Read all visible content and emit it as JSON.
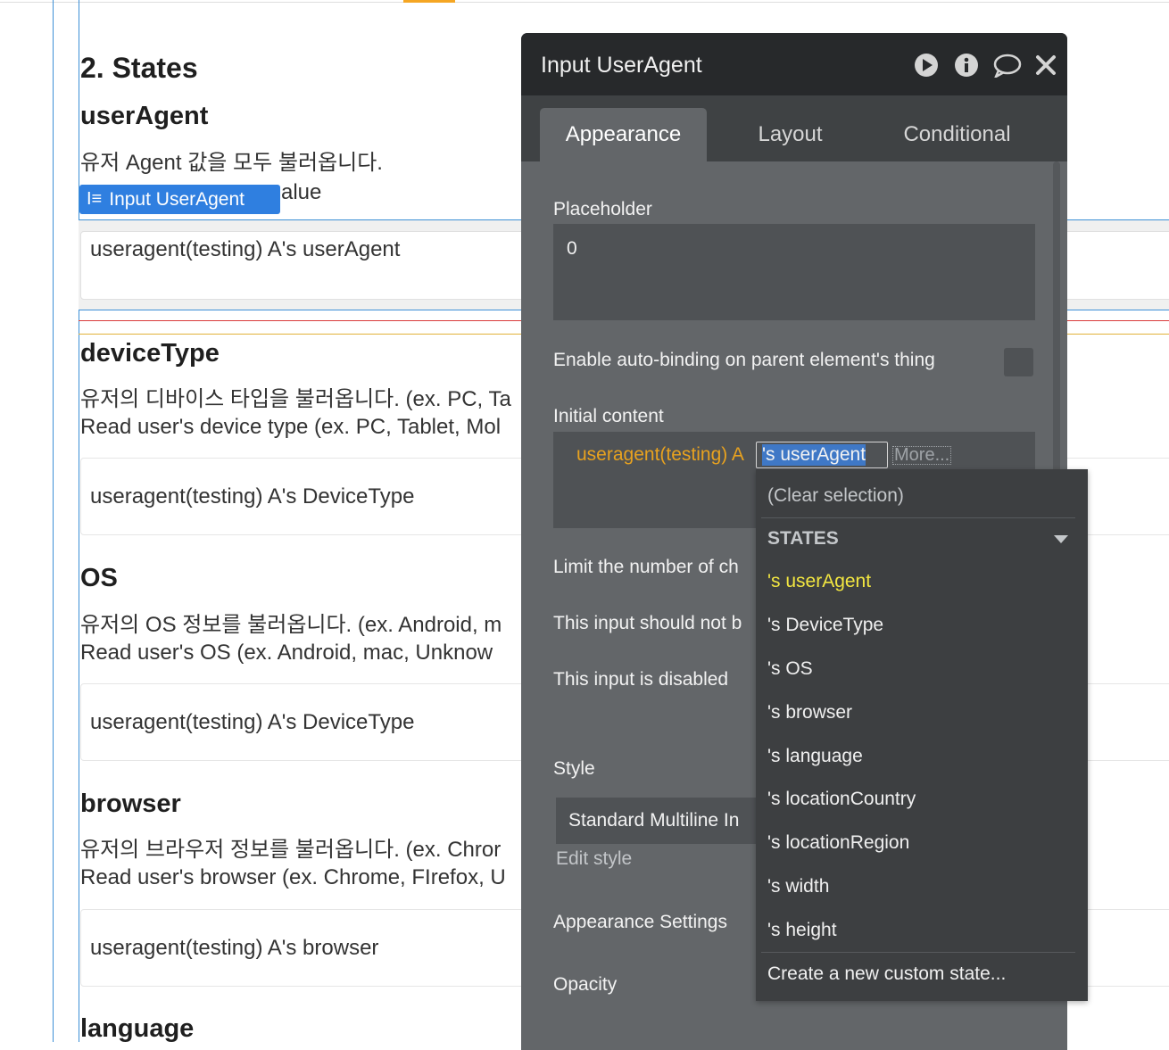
{
  "canvas": {
    "section_title": "2. States",
    "user_agent": {
      "heading": "userAgent",
      "desc_ko": "유저 Agent 값을 모두 불러옵니다.",
      "desc_partial": "alue",
      "element_tag": "Input UserAgent",
      "input_value": "useragent(testing) A's userAgent"
    },
    "device_type": {
      "heading": "deviceType",
      "desc_ko": "유저의 디바이스 타입을 불러옵니다. (ex. PC, Ta",
      "desc_en": "Read user's device type (ex. PC, Tablet, Mol",
      "input_value": "useragent(testing) A's DeviceType"
    },
    "os": {
      "heading": "OS",
      "desc_ko": "유저의 OS  정보를 불러옵니다. (ex. Android, m",
      "desc_en": "Read user's OS (ex. Android, mac, Unknow",
      "input_value": "useragent(testing) A's DeviceType"
    },
    "browser": {
      "heading": "browser",
      "desc_ko": "유저의 브라우저  정보를 불러옵니다. (ex. Chror",
      "desc_en": "Read user's browser (ex. Chrome, FIrefox, U",
      "input_value": "useragent(testing) A's browser"
    },
    "language": {
      "heading": "language"
    }
  },
  "panel": {
    "title": "Input UserAgent",
    "header_icons": [
      "play-icon",
      "info-icon",
      "comment-icon",
      "close-icon"
    ],
    "tabs": [
      "Appearance",
      "Layout",
      "Conditional"
    ],
    "active_tab": "Appearance",
    "placeholder_label": "Placeholder",
    "placeholder_value": "0",
    "autobinding_label": "Enable auto-binding on parent element's thing",
    "initial_content_label": "Initial content",
    "initial_content_prefix": "useragent(testing) A",
    "initial_content_selected": "'s userAgent",
    "more_label": "More...",
    "limit_label": "Limit the number of ch",
    "not_empty_label": "This input should not b",
    "disabled_label": "This input is disabled",
    "style_label": "Style",
    "style_value": "Standard Multiline In",
    "edit_style_label": "Edit style",
    "appearance_settings_label": "Appearance Settings",
    "opacity_label": "Opacity"
  },
  "dropdown": {
    "clear_label": "(Clear selection)",
    "group_label": "STATES",
    "items": [
      "'s userAgent",
      "'s DeviceType",
      "'s OS",
      "'s browser",
      "'s language",
      "'s locationCountry",
      "'s locationRegion",
      "'s width",
      "'s height"
    ],
    "selected_index": 0,
    "create_label": "Create a new custom state...",
    "colors": {
      "selected": "#f2e641",
      "background": "#3d3f41"
    }
  },
  "colors": {
    "accent_blue": "#2f7fe0",
    "expression_orange": "#e8a21f",
    "panel_bg": "#636669",
    "panel_header": "#27292b"
  }
}
